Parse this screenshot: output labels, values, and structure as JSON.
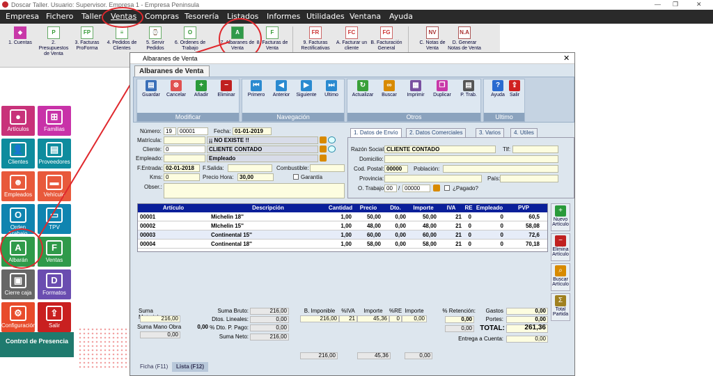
{
  "window": {
    "title": "Doscar Taller. Usuario: Supervisor. Empresa 1 - Empresa Peninsula"
  },
  "menu": [
    "Empresa",
    "Fichero",
    "Taller",
    "Ventas",
    "Compras",
    "Tesorería",
    "Listados",
    "Informes",
    "Utilidades",
    "Ventana",
    "Ayuda"
  ],
  "ribbon": [
    {
      "label": "1. Cuentas",
      "icon": "cuentas-icon",
      "glyph": "◆"
    },
    {
      "label": "2. Presupuestos de Venta",
      "icon": "presupuestos-icon",
      "glyph": "P"
    },
    {
      "label": "3. Facturas ProForma",
      "icon": "proforma-icon",
      "glyph": "FP"
    },
    {
      "label": "4. Pedidos de Clientes",
      "icon": "pedidos-icon",
      "glyph": "≡"
    },
    {
      "label": "5. Servir Pedidos",
      "icon": "servir-icon",
      "glyph": "⌚"
    },
    {
      "label": "6. Ordenes de Trabajo",
      "icon": "ordenes-icon",
      "glyph": "O"
    },
    {
      "label": "7. Albaranes de Venta",
      "icon": "albaranes-icon",
      "glyph": "A"
    },
    {
      "label": "8. Facturas de Venta",
      "icon": "facturas-icon",
      "glyph": "F"
    },
    {
      "label": "9. Facturas Rectificativas",
      "icon": "rectificativas-icon",
      "glyph": "FR"
    },
    {
      "label": "A. Facturar un cliente",
      "icon": "facturar-cliente-icon",
      "glyph": "FC"
    },
    {
      "label": "B. Facturación General",
      "icon": "facturacion-general-icon",
      "glyph": "FG"
    },
    {
      "label": "C. Notas de Venta",
      "icon": "notas-icon",
      "glyph": "NV"
    },
    {
      "label": "D. Generar Notas de Venta",
      "icon": "generar-notas-icon",
      "glyph": "N.A"
    }
  ],
  "tiles": [
    {
      "label": "Artículos",
      "icon": "articulos-icon",
      "glyph": "●",
      "color": "#c8327a"
    },
    {
      "label": "Familias",
      "icon": "familias-icon",
      "glyph": "⊞",
      "color": "#c832a8"
    },
    {
      "label": "Clientes",
      "icon": "clientes-icon",
      "glyph": "👤",
      "color": "#0e8c9e"
    },
    {
      "label": "Proveedores",
      "icon": "proveedores-icon",
      "glyph": "▤",
      "color": "#0e8c9e"
    },
    {
      "label": "Empleados",
      "icon": "empleados-icon",
      "glyph": "☻",
      "color": "#e8593b"
    },
    {
      "label": "Vehículo",
      "icon": "vehiculo-icon",
      "glyph": "▬",
      "color": "#e8593b"
    },
    {
      "label": "Orden Trabajo",
      "icon": "orden-trabajo-icon",
      "glyph": "O",
      "color": "#0f84b0"
    },
    {
      "label": "TPV",
      "icon": "tpv-icon",
      "glyph": "▭",
      "color": "#0f84b0"
    },
    {
      "label": "Albarán",
      "icon": "albaran-icon",
      "glyph": "A",
      "color": "#2f9a4a"
    },
    {
      "label": "Ventas",
      "icon": "ventas-icon",
      "glyph": "F",
      "color": "#2f9a4a"
    },
    {
      "label": "Cierre caja",
      "icon": "cierre-caja-icon",
      "glyph": "▣",
      "color": "#666"
    },
    {
      "label": "Formatos",
      "icon": "formatos-icon",
      "glyph": "D",
      "color": "#6a4db0"
    },
    {
      "label": "Configuración",
      "icon": "configuracion-icon",
      "glyph": "⚙",
      "color": "#e84b2b"
    },
    {
      "label": "Salir",
      "icon": "salir-icon",
      "glyph": "⇪",
      "color": "#c92020"
    }
  ],
  "control": "Control de Presencia",
  "form_window": {
    "title": "Albaranes de Venta",
    "tab": "Albaranes de Venta"
  },
  "toolbar": {
    "groups": [
      "Modificar",
      "Navegación",
      "Otros",
      "Ultimo"
    ],
    "buttons": [
      {
        "label": "Guardar",
        "icon": "save-icon",
        "glyph": "▤",
        "color": "#3a6fb8"
      },
      {
        "label": "Cancelar",
        "icon": "cancel-icon",
        "glyph": "⊗",
        "color": "#e05050"
      },
      {
        "label": "Añadir",
        "icon": "add-icon",
        "glyph": "+",
        "color": "#2a9a3a"
      },
      {
        "label": "Eliminar",
        "icon": "delete-icon",
        "glyph": "−",
        "color": "#c02020"
      },
      {
        "label": "Primero",
        "icon": "first-icon",
        "glyph": "⏮",
        "color": "#2a8ad0"
      },
      {
        "label": "Anterior",
        "icon": "previous-icon",
        "glyph": "◀",
        "color": "#2a8ad0"
      },
      {
        "label": "Siguiente",
        "icon": "next-icon",
        "glyph": "▶",
        "color": "#2a8ad0"
      },
      {
        "label": "Ultimo",
        "icon": "last-icon",
        "glyph": "⏭",
        "color": "#2a8ad0"
      },
      {
        "label": "Actualizar",
        "icon": "refresh-icon",
        "glyph": "↻",
        "color": "#3aa03a"
      },
      {
        "label": "Buscar",
        "icon": "binoculars-icon",
        "glyph": "∞",
        "color": "#d88a00"
      },
      {
        "label": "Imprimir",
        "icon": "print-icon",
        "glyph": "▦",
        "color": "#7a50a0"
      },
      {
        "label": "Duplicar",
        "icon": "duplicate-icon",
        "glyph": "❐",
        "color": "#c838a8"
      },
      {
        "label": "P. Trab.",
        "icon": "ptrab-icon",
        "glyph": "▤",
        "color": "#555"
      },
      {
        "label": "Ayuda",
        "icon": "help-icon",
        "glyph": "?",
        "color": "#2a6ad0"
      },
      {
        "label": "Salir",
        "icon": "exit-icon",
        "glyph": "⇪",
        "color": "#d02020"
      }
    ]
  },
  "form": {
    "numero_label": "Número:",
    "serie": "19",
    "numero": "00001",
    "fecha_label": "Fecha:",
    "fecha": "01-01-2019",
    "matricula_label": "Matrícula:",
    "matricula": "",
    "matricula_status": "¡¡ NO EXISTE !!",
    "cliente_label": "Cliente:",
    "cliente_code": "0",
    "cliente_name": "CLIENTE CONTADO",
    "empleado_label": "Empleado:",
    "empleado_code": "",
    "empleado_name": "Empleado",
    "fentrada_label": "F.Entrada:",
    "fentrada": "02-01-2018",
    "fsalida_label": "F.Salida:",
    "fsalida": "",
    "combustible_label": "Combustible:",
    "combustible": "",
    "kms_label": "Kms:",
    "kms": "0",
    "precio_label": "Precio Hora:",
    "precio": "30,00",
    "garantia_label": "Garantía",
    "obser_label": "Obser.:"
  },
  "right_tabs": [
    "1. Datos de Envío",
    "2. Datos Comerciales",
    "3. Varios",
    "4. Utiles"
  ],
  "envio": {
    "razon_label": "Razón Social:",
    "razon": "CLIENTE CONTADO",
    "tlf_label": "Tlf:",
    "domicilio_label": "Domicilio:",
    "cp_label": "Cod. Postal:",
    "cp": "00000",
    "poblacion_label": "Población:",
    "provincia_label": "Provincia:",
    "pais_label": "País:",
    "otrabajo_label": "O. Trabajo:",
    "otrabajo_a": "00",
    "otrabajo_b": "00000",
    "pagado_label": "¿Pagado?"
  },
  "grid": {
    "headers": [
      "Artículo",
      "Descripción",
      "Cantidad",
      "Precio",
      "Dto.",
      "Importe",
      "IVA",
      "RE",
      "Empleado",
      "PVP"
    ],
    "rows": [
      [
        "00001",
        "Michelin 18''",
        "1,00",
        "50,00",
        "0,00",
        "50,00",
        "21",
        "0",
        "0",
        "60,5"
      ],
      [
        "00002",
        "MIchelin 15''",
        "1,00",
        "48,00",
        "0,00",
        "48,00",
        "21",
        "0",
        "0",
        "58,08"
      ],
      [
        "00003",
        "Continental 15''",
        "1,00",
        "60,00",
        "0,00",
        "60,00",
        "21",
        "0",
        "0",
        "72,6"
      ],
      [
        "00004",
        "Continental 18''",
        "1,00",
        "58,00",
        "0,00",
        "58,00",
        "21",
        "0",
        "0",
        "70,18"
      ]
    ]
  },
  "side_buttons": [
    {
      "label": "Nuevo Artículo",
      "icon": "new-article-icon",
      "glyph": "+",
      "color": "#2a9a3a"
    },
    {
      "label": "Elimina Artículo",
      "icon": "delete-article-icon",
      "glyph": "−",
      "color": "#c02020"
    },
    {
      "label": "Buscar Artículo",
      "icon": "search-article-icon",
      "glyph": "⌕",
      "color": "#d88a00"
    },
    {
      "label": "Total Partida",
      "icon": "total-partida-icon",
      "glyph": "Σ",
      "color": "#a08020"
    }
  ],
  "totals": {
    "suma_materiales_label": "Suma Materiales",
    "suma_materiales": "216,00",
    "suma_mano_label": "Suma Mano Obra",
    "suma_mano": "0,00",
    "suma_bruto_label": "Suma Bruto:",
    "suma_bruto": "216,00",
    "dto_lineales_label": "Dtos. Lineales:",
    "dto_lineales": "0,00",
    "pct_dto_value": "0,00",
    "pct_dto_label": "% Dto. P. Pago:",
    "pct_dto": "0,00",
    "suma_neto_label": "Suma Neto:",
    "suma_neto": "216,00",
    "blank_value": "0,00",
    "iva_headers": [
      "B. Imponible",
      "%IVA",
      "Importe",
      "%RE",
      "Importe"
    ],
    "iva_row": [
      "216,00",
      "21",
      "45,36",
      "0",
      "0,00"
    ],
    "iva_totals": [
      "216,00",
      "45,36",
      "0,00"
    ],
    "retencion_label": "% Retención:",
    "retencion_pct": "0,00",
    "retencion": "0,00",
    "gastos_label": "Gastos",
    "gastos": "0,00",
    "portes_label": "Portes:",
    "portes": "0,00",
    "total_label": "TOTAL:",
    "total": "261,36",
    "entrega_label": "Entrega a Cuenta:",
    "entrega": "0,00"
  },
  "bottom_tabs": [
    "Ficha (F11)",
    "Lista (F12)"
  ]
}
